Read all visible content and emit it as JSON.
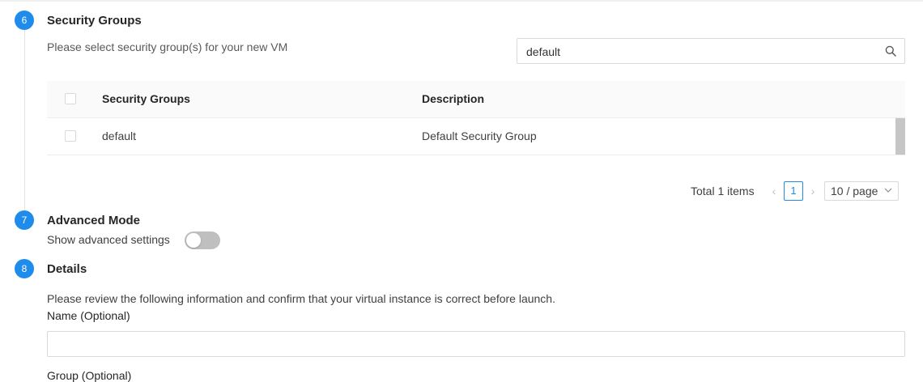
{
  "steps": {
    "security_groups": {
      "number": "6",
      "title": "Security Groups",
      "hint": "Please select security group(s) for your new VM",
      "search": {
        "value": "default"
      },
      "table": {
        "columns": [
          "Security Groups",
          "Description"
        ],
        "rows": [
          {
            "name": "default",
            "description": "Default Security Group"
          }
        ]
      },
      "pagination": {
        "total_text": "Total 1 items",
        "current_page": "1",
        "page_size": "10 / page"
      }
    },
    "advanced_mode": {
      "number": "7",
      "title": "Advanced Mode",
      "toggle_label": "Show advanced settings",
      "toggle_on": false
    },
    "details": {
      "number": "8",
      "title": "Details",
      "hint": "Please review the following information and confirm that your virtual instance is correct before launch.",
      "name_label": "Name (Optional)",
      "group_label": "Group (Optional)"
    }
  },
  "colors": {
    "accent": "#1f8ceb",
    "toggle_off": "#bfbfbf"
  },
  "icons": {
    "search": "search-icon",
    "prev": "chevron-left-icon",
    "next": "chevron-right-icon",
    "dropdown": "chevron-down-icon"
  }
}
